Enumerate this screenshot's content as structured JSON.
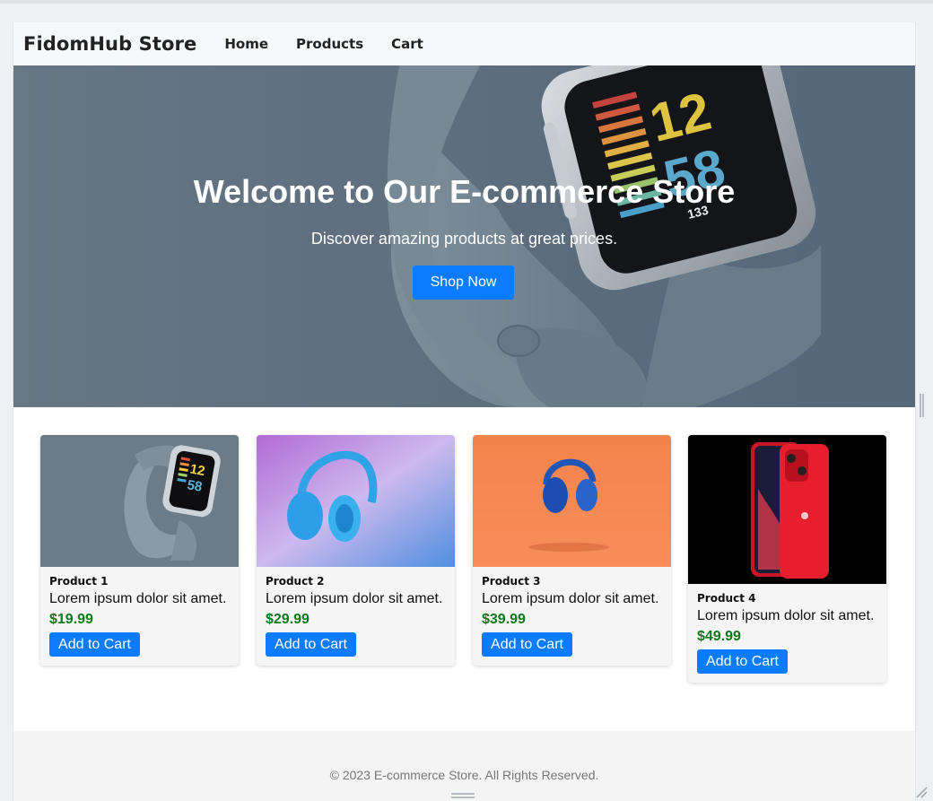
{
  "header": {
    "brand": "FidomHub Store",
    "nav": [
      "Home",
      "Products",
      "Cart"
    ]
  },
  "hero": {
    "title": "Welcome to Our E-commerce Store",
    "subtitle": "Discover amazing products at great prices.",
    "button": "Shop Now",
    "watch_display": [
      "12",
      "58",
      "133"
    ]
  },
  "products": [
    {
      "name": "Product 1",
      "description": "Lorem ipsum dolor sit amet.",
      "price": "$19.99",
      "button": "Add to Cart",
      "image": "smartwatch-band-image",
      "image_display": [
        "12",
        "58"
      ]
    },
    {
      "name": "Product 2",
      "description": "Lorem ipsum dolor sit amet.",
      "price": "$29.99",
      "button": "Add to Cart",
      "image": "blue-headphones-image"
    },
    {
      "name": "Product 3",
      "description": "Lorem ipsum dolor sit amet.",
      "price": "$39.99",
      "button": "Add to Cart",
      "image": "navy-headphones-image"
    },
    {
      "name": "Product 4",
      "description": "Lorem ipsum dolor sit amet.",
      "price": "$49.99",
      "button": "Add to Cart",
      "image": "red-smartphone-image"
    }
  ],
  "footer": {
    "copyright": "© 2023 E-commerce Store. All Rights Reserved."
  },
  "colors": {
    "primary_button": "#0b7cff",
    "price": "#0a7a1a",
    "hero_bg": "#5f7080",
    "nav_bg": "#f7f8f9"
  }
}
